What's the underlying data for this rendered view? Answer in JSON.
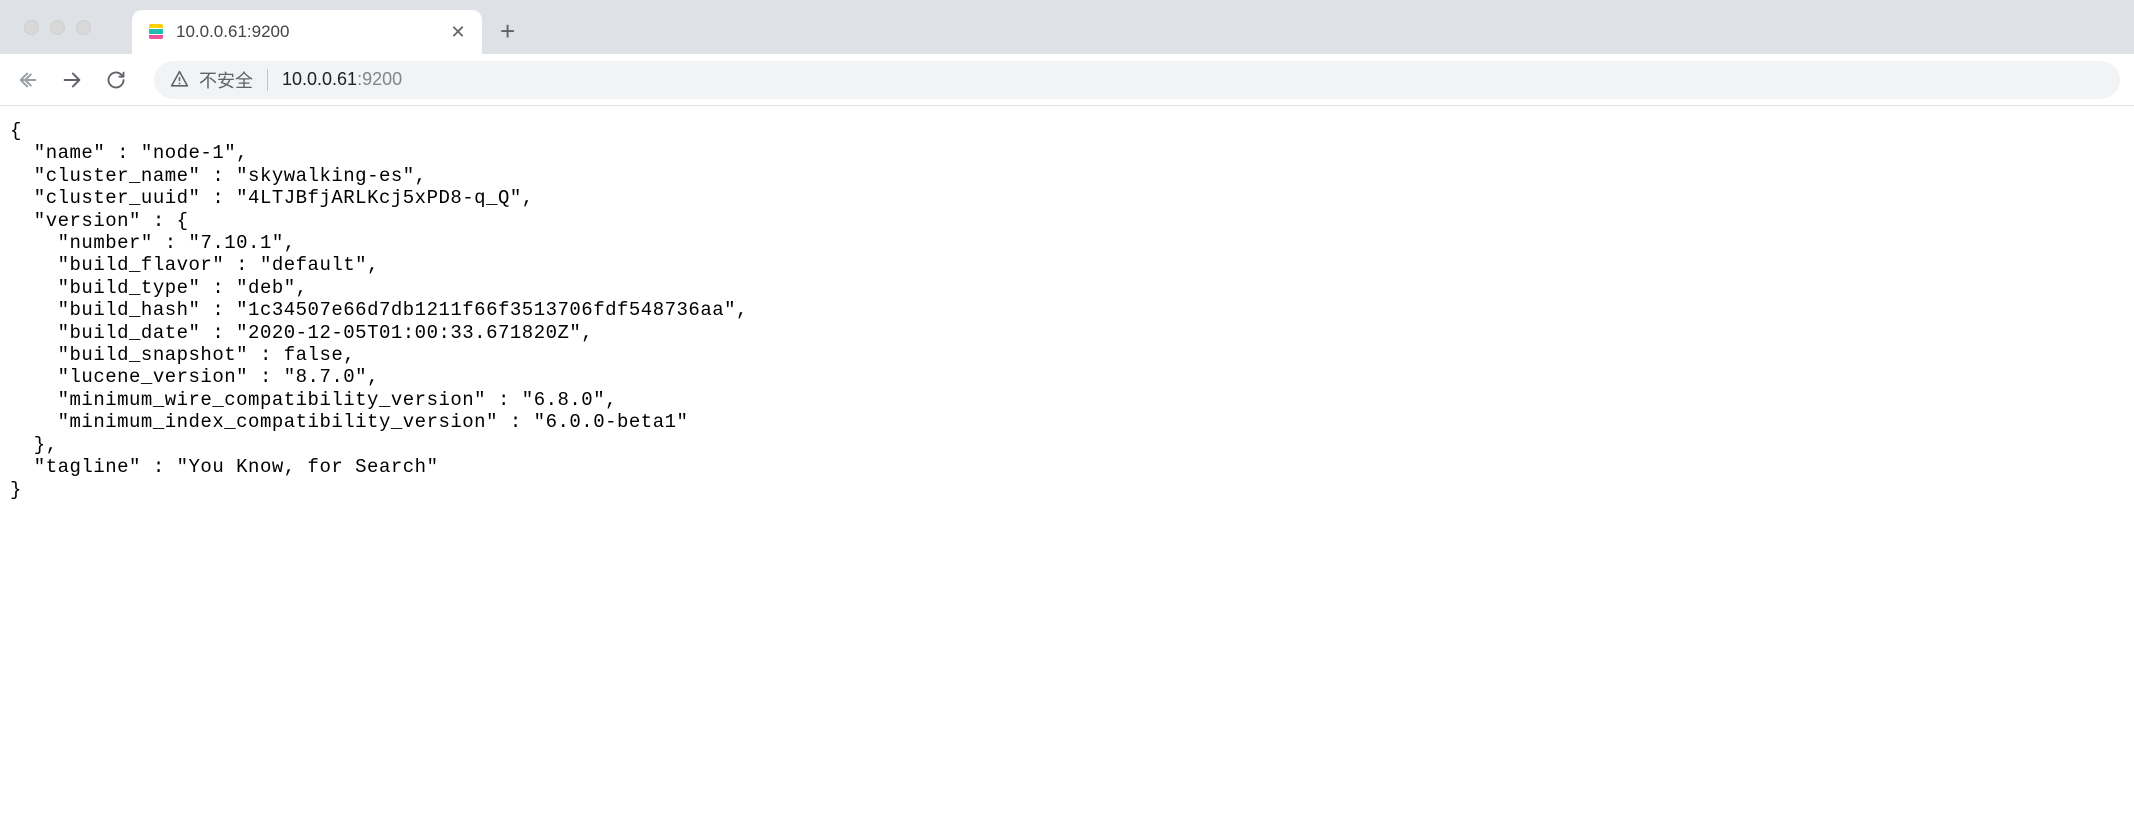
{
  "tab": {
    "title": "10.0.0.61:9200"
  },
  "address": {
    "insecure_label": "不安全",
    "host": "10.0.0.61",
    "port": ":9200"
  },
  "response": {
    "name": "node-1",
    "cluster_name": "skywalking-es",
    "cluster_uuid": "4LTJBfjARLKcj5xPD8-q_Q",
    "version_number": "7.10.1",
    "build_flavor": "default",
    "build_type": "deb",
    "build_hash": "1c34507e66d7db1211f66f3513706fdf548736aa",
    "build_date": "2020-12-05T01:00:33.671820Z",
    "build_snapshot": "false",
    "lucene_version": "8.7.0",
    "minimum_wire_compatibility_version": "6.8.0",
    "minimum_index_compatibility_version": "6.0.0-beta1",
    "tagline": "You Know, for Search"
  }
}
